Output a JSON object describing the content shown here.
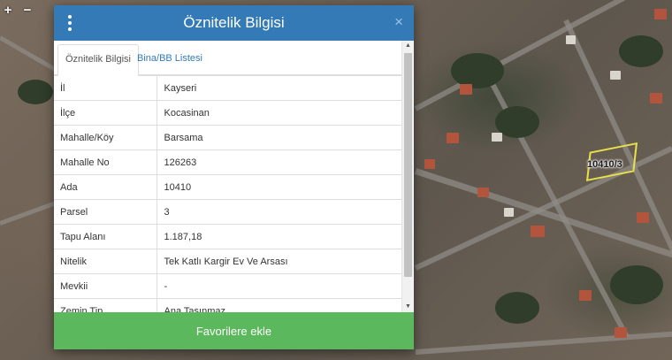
{
  "map": {
    "zoom_in": "+",
    "zoom_out": "−",
    "parcel_label": "10410/3",
    "colors": {
      "parcel_outline": "#e8e04a"
    }
  },
  "modal": {
    "title": "Öznitelik Bilgisi",
    "menu_icon": "vertical-ellipsis-icon",
    "close_icon": "×",
    "tabs": [
      {
        "label": "Öznitelik Bilgisi",
        "active": true
      },
      {
        "label": "Bina/BB Listesi",
        "active": false
      }
    ],
    "rows": [
      {
        "key": "İl",
        "value": "Kayseri"
      },
      {
        "key": "İlçe",
        "value": "Kocasinan"
      },
      {
        "key": "Mahalle/Köy",
        "value": "Barsama"
      },
      {
        "key": "Mahalle No",
        "value": "126263"
      },
      {
        "key": "Ada",
        "value": "10410"
      },
      {
        "key": "Parsel",
        "value": "3"
      },
      {
        "key": "Tapu Alanı",
        "value": "1.187,18"
      },
      {
        "key": "Nitelik",
        "value": "Tek Katlı Kargir Ev Ve Arsası"
      },
      {
        "key": "Mevkii",
        "value": "-"
      },
      {
        "key": "Zemin Tip",
        "value": "Ana Taşınmaz"
      }
    ],
    "favorite_button": "Favorilere ekle",
    "colors": {
      "header": "#337ab7",
      "button": "#5cb85c",
      "tab_link": "#337ab7"
    }
  }
}
